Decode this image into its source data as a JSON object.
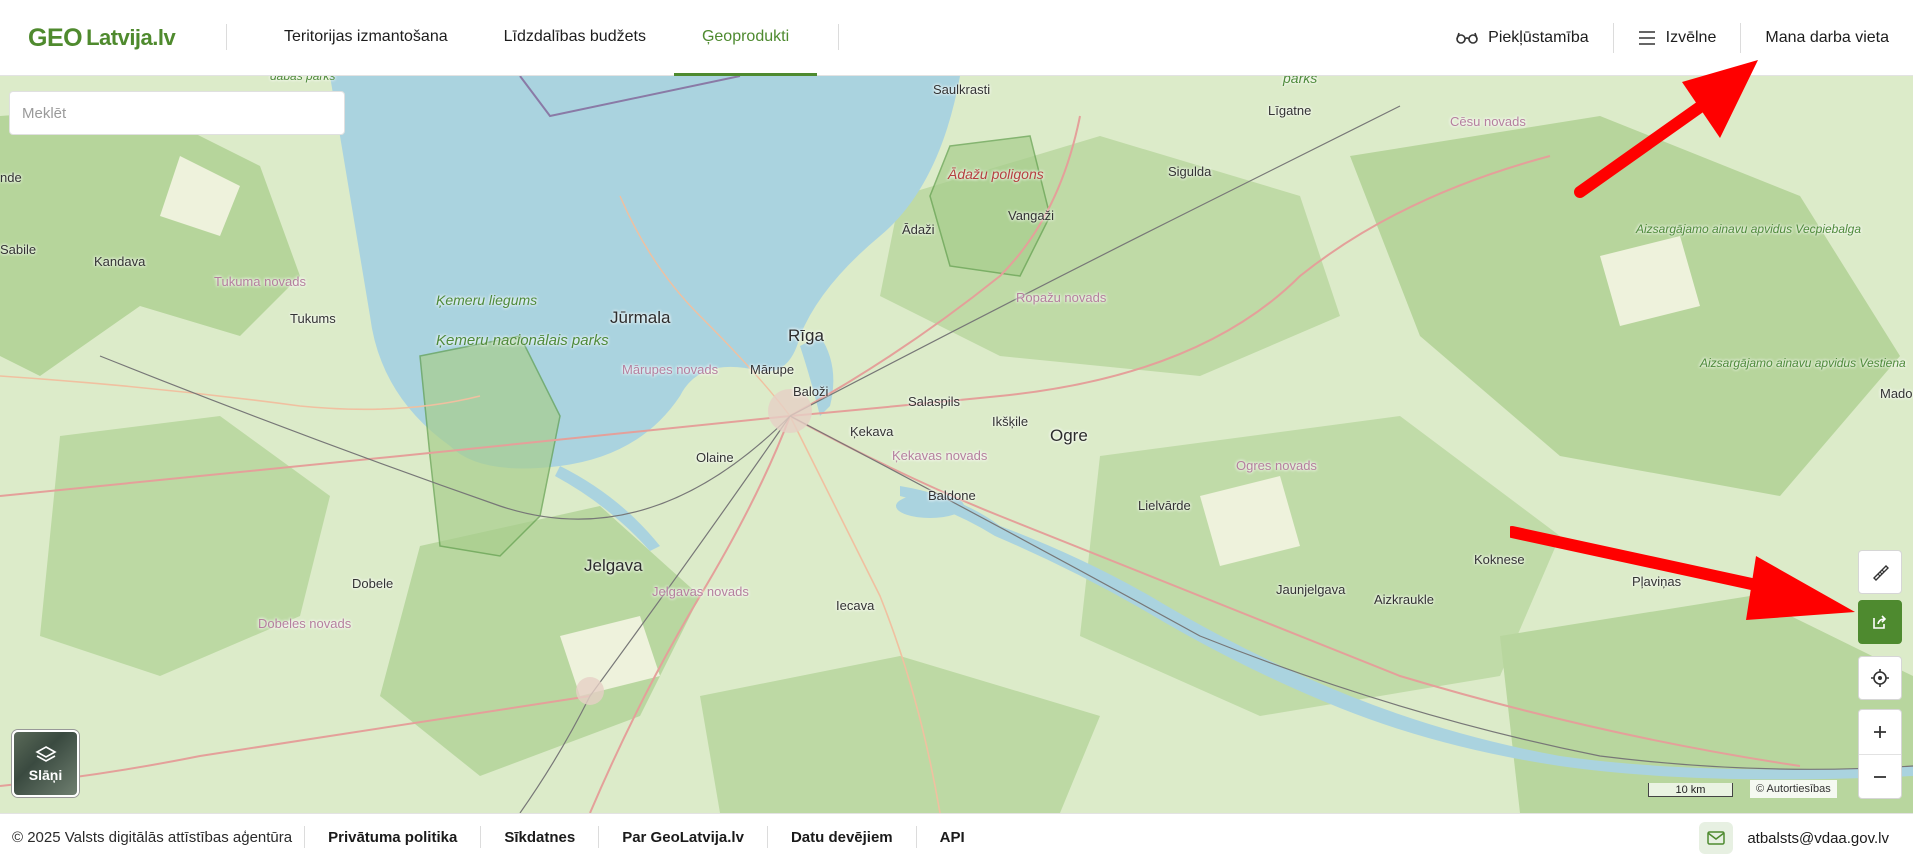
{
  "header": {
    "logo_geo": "GEO",
    "logo_rest": "Latvija.lv",
    "nav": [
      {
        "label": "Teritorijas izmantošana",
        "active": false
      },
      {
        "label": "Līdzdalības budžets",
        "active": false
      },
      {
        "label": "Ģeoprodukti",
        "active": true
      }
    ],
    "accessibility": "Piekļūstamība",
    "menu": "Izvēlne",
    "workspace": "Mana darba vieta"
  },
  "search": {
    "placeholder": "Meklēt"
  },
  "map": {
    "labels": {
      "saulkrasti": "Saulkrasti",
      "ligatne": "Līgatne",
      "cesu": "Cēsu novads",
      "adazu_poligons": "Ādažu poligons",
      "sigulda": "Sigulda",
      "vangazi": "Vangaži",
      "adazi": "Ādaži",
      "kandava": "Kandava",
      "tukuma": "Tukuma novads",
      "tukums": "Tukums",
      "kemeru_liegums": "Ķemeru liegums",
      "kemeru_parks": "Ķemeru nacionālais parks",
      "jurmala": "Jūrmala",
      "riga": "Rīga",
      "ropazu": "Ropažu novads",
      "marupes": "Mārupes novads",
      "marupe": "Mārupe",
      "balozi": "Baloži",
      "salaspils": "Salaspils",
      "ikskile": "Ikšķile",
      "ogre": "Ogre",
      "kekava": "Ķekava",
      "kekavas": "Ķekavas novads",
      "olaine": "Olaine",
      "baldone": "Baldone",
      "ogres": "Ogres novads",
      "lielvarde": "Lielvārde",
      "jelgava": "Jelgava",
      "jelgavas": "Jelgavas novads",
      "dobele": "Dobele",
      "dobeles": "Dobeles novads",
      "iecava": "Iecava",
      "jaunjelgava": "Jaunjelgava",
      "aizkraukle": "Aizkraukle",
      "koknese": "Koknese",
      "plavinas": "Pļaviņas",
      "madona": "Mado",
      "ende": "nde",
      "sabile": "Sabile",
      "parks_top": "parks",
      "dabas_parks": "dabas parks",
      "vecpiebalga": "Aizsargājamo ainavu apvidus Vecpiebalga",
      "vestiena": "Aizsargājamo ainavu apvidus Vestiena"
    },
    "layers_label": "Slāņi",
    "scale": "10 km",
    "attribution": "© Autortiesības"
  },
  "footer": {
    "copyright": "© 2025 Valsts digitālās attīstības aģentūra",
    "links": [
      "Privātuma politika",
      "Sīkdatnes",
      "Par GeoLatvija.lv",
      "Datu devējiem",
      "API"
    ],
    "email": "atbalsts@vdaa.gov.lv"
  },
  "colors": {
    "brand_green": "#4e8a2f",
    "logo_red": "#b8202a",
    "water": "#aad3df",
    "arrow_red": "#ff0000"
  }
}
